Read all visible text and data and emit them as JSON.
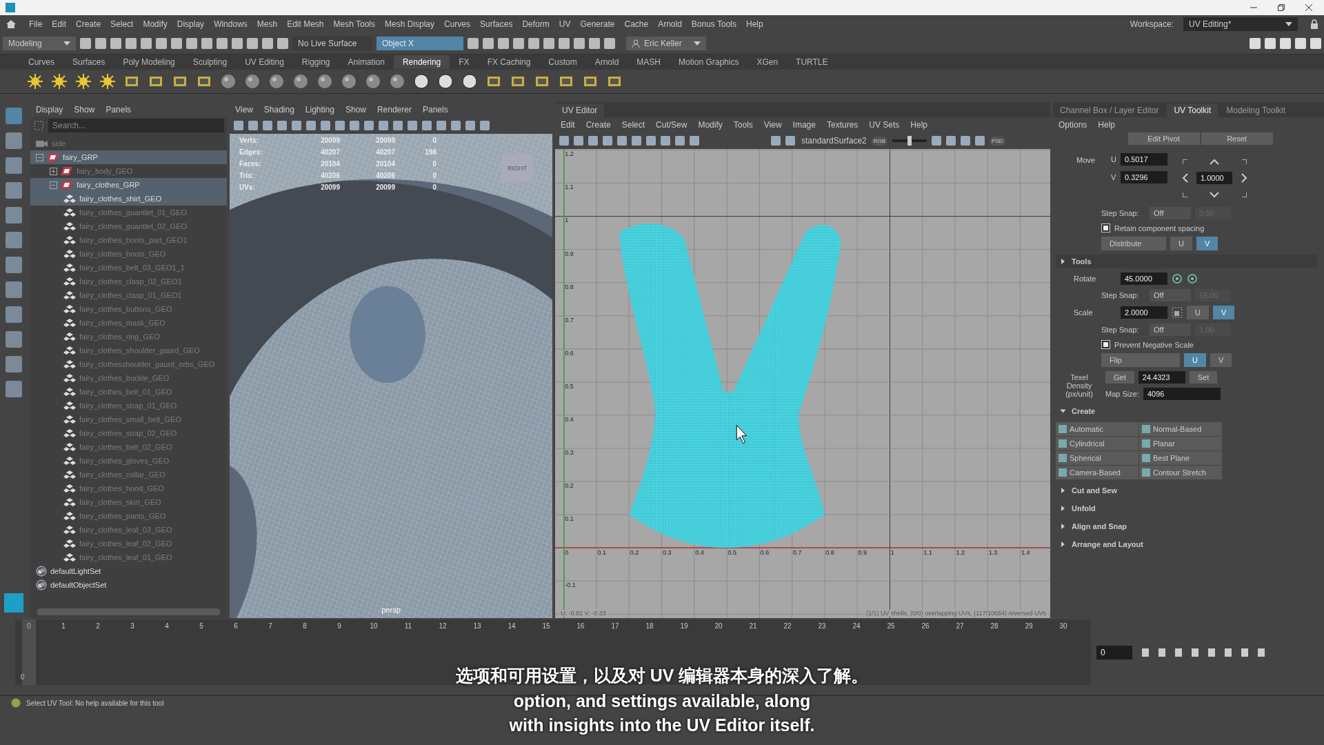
{
  "menu_bar": [
    "File",
    "Edit",
    "Create",
    "Select",
    "Modify",
    "Display",
    "Windows",
    "Mesh",
    "Edit Mesh",
    "Mesh Tools",
    "Mesh Display",
    "Curves",
    "Surfaces",
    "Deform",
    "UV",
    "Generate",
    "Cache",
    "Arnold",
    "Bonus Tools",
    "Help"
  ],
  "status_line": {
    "mode": "Modeling",
    "live_surface": "No Live Surface",
    "symmetry": "Object X",
    "user": "Eric Keller",
    "workspace_label": "Workspace:",
    "workspace": "UV Editing*"
  },
  "shelf": {
    "tabs": [
      {
        "label": "Curves",
        "selected": false
      },
      {
        "label": "Surfaces",
        "selected": false
      },
      {
        "label": "Poly Modeling",
        "selected": false
      },
      {
        "label": "Sculpting",
        "selected": false
      },
      {
        "label": "UV Editing",
        "selected": false
      },
      {
        "label": "Rigging",
        "selected": false
      },
      {
        "label": "Animation",
        "selected": false
      },
      {
        "label": "Rendering",
        "selected": true
      },
      {
        "label": "FX",
        "selected": false
      },
      {
        "label": "FX Caching",
        "selected": false
      },
      {
        "label": "Custom",
        "selected": false
      },
      {
        "label": "Arnold",
        "selected": false
      },
      {
        "label": "MASH",
        "selected": false
      },
      {
        "label": "Motion Graphics",
        "selected": false
      },
      {
        "label": "XGen",
        "selected": false
      },
      {
        "label": "TURTLE",
        "selected": false
      }
    ]
  },
  "outliner": {
    "menu": [
      "Display",
      "Show",
      "Panels"
    ],
    "search": {
      "placeholder": "Search..."
    },
    "tree": [
      {
        "label": "side",
        "kind": "camera",
        "hidden": true,
        "selected": false
      },
      {
        "label": "fairy_GRP",
        "kind": "group",
        "expanded": true,
        "hidden": false,
        "selected": true,
        "children": [
          {
            "label": "fairy_body_GEO",
            "kind": "group",
            "expanded": false,
            "hidden": true,
            "selected": false
          },
          {
            "label": "fairy_clothes_GRP",
            "kind": "group",
            "expanded": true,
            "hidden": false,
            "selected": true,
            "children": [
              {
                "label": "fairy_clothes_shirt_GEO",
                "kind": "mesh",
                "hidden": false,
                "selected": true
              },
              {
                "label": "fairy_clothes_guantlet_01_GEO",
                "kind": "mesh",
                "hidden": true,
                "selected": false
              },
              {
                "label": "fairy_clothes_guantlet_02_GEO",
                "kind": "mesh",
                "hidden": true,
                "selected": false
              },
              {
                "label": "fairy_clothes_boots_part_GEO1",
                "kind": "mesh",
                "hidden": true,
                "selected": false
              },
              {
                "label": "fairy_clothes_boots_GEO",
                "kind": "mesh",
                "hidden": true,
                "selected": false
              },
              {
                "label": "fairy_clothes_belt_03_GEO1_1",
                "kind": "mesh",
                "hidden": true,
                "selected": false
              },
              {
                "label": "fairy_clothes_clasp_02_GEO1",
                "kind": "mesh",
                "hidden": true,
                "selected": false
              },
              {
                "label": "fairy_clothes_clasp_01_GEO1",
                "kind": "mesh",
                "hidden": true,
                "selected": false
              },
              {
                "label": "fairy_clothes_buttons_GEO",
                "kind": "mesh",
                "hidden": true,
                "selected": false
              },
              {
                "label": "fairy_clothes_mask_GEO",
                "kind": "mesh",
                "hidden": true,
                "selected": false
              },
              {
                "label": "fairy_clothes_ring_GEO",
                "kind": "mesh",
                "hidden": true,
                "selected": false
              },
              {
                "label": "fairy_clothes_shoulder_gaurd_GEO",
                "kind": "mesh",
                "hidden": true,
                "selected": false
              },
              {
                "label": "fairy_clothesshoulder_gaurd_orbs_GEO",
                "kind": "mesh",
                "hidden": true,
                "selected": false
              },
              {
                "label": "fairy_clothes_buckle_GEO",
                "kind": "mesh",
                "hidden": true,
                "selected": false
              },
              {
                "label": "fairy_clothes_belt_01_GEO",
                "kind": "mesh",
                "hidden": true,
                "selected": false
              },
              {
                "label": "fairy_clothes_strap_01_GEO",
                "kind": "mesh",
                "hidden": true,
                "selected": false
              },
              {
                "label": "fairy_clothes_small_belt_GEO",
                "kind": "mesh",
                "hidden": true,
                "selected": false
              },
              {
                "label": "fairy_clothes_strap_02_GEO",
                "kind": "mesh",
                "hidden": true,
                "selected": false
              },
              {
                "label": "fairy_clothes_belt_02_GEO",
                "kind": "mesh",
                "hidden": true,
                "selected": false
              },
              {
                "label": "fairy_clothes_gloves_GEO",
                "kind": "mesh",
                "hidden": true,
                "selected": false
              },
              {
                "label": "fairy_clothes_collar_GEO",
                "kind": "mesh",
                "hidden": true,
                "selected": false
              },
              {
                "label": "fairy_clothes_hood_GEO",
                "kind": "mesh",
                "hidden": true,
                "selected": false
              },
              {
                "label": "fairy_clothes_skirt_GEO",
                "kind": "mesh",
                "hidden": true,
                "selected": false
              },
              {
                "label": "fairy_clothes_pants_GEO",
                "kind": "mesh",
                "hidden": true,
                "selected": false
              },
              {
                "label": "fairy_clothes_leaf_03_GEO",
                "kind": "mesh",
                "hidden": true,
                "selected": false
              },
              {
                "label": "fairy_clothes_leaf_02_GEO",
                "kind": "mesh",
                "hidden": true,
                "selected": false
              },
              {
                "label": "fairy_clothes_leaf_01_GEO",
                "kind": "mesh",
                "hidden": true,
                "selected": false
              }
            ]
          }
        ]
      },
      {
        "label": "defaultLightSet",
        "kind": "set",
        "hidden": false,
        "selected": false
      },
      {
        "label": "defaultObjectSet",
        "kind": "set",
        "hidden": false,
        "selected": false
      }
    ]
  },
  "viewport": {
    "menu": [
      "View",
      "Shading",
      "Lighting",
      "Show",
      "Renderer",
      "Panels"
    ],
    "stats": [
      {
        "label": "Verts:",
        "values": [
          "20099",
          "20099",
          "0"
        ]
      },
      {
        "label": "Edges:",
        "values": [
          "40207",
          "40207",
          "198"
        ]
      },
      {
        "label": "Faces:",
        "values": [
          "20104",
          "20104",
          "0"
        ]
      },
      {
        "label": "Tris:",
        "values": [
          "40206",
          "40206",
          "0"
        ]
      },
      {
        "label": "UVs:",
        "values": [
          "20099",
          "20099",
          "0"
        ]
      }
    ],
    "view_cube": "RIGHT",
    "camera": "persp"
  },
  "uv_editor": {
    "title": "UV Editor",
    "menu": [
      "Edit",
      "Create",
      "Select",
      "Cut/Sew",
      "Modify",
      "Tools",
      "View",
      "Image",
      "Textures",
      "UV Sets",
      "Help"
    ],
    "texture": "standardSurface2",
    "exposure": {
      "level": 0.5
    },
    "channel_button": "RGB",
    "psd_button": "PSD",
    "u_labels": [
      "0",
      "0.1",
      "0.2",
      "0.3",
      "0.4",
      "0.5",
      "0.6",
      "0.7",
      "0.8",
      "0.9",
      "1",
      "1.1",
      "1.2",
      "1.3",
      "1.4"
    ],
    "v_labels": [
      "1.2",
      "1.1",
      "1",
      "0.9",
      "0.8",
      "0.7",
      "0.6",
      "0.5",
      "0.4",
      "0.3",
      "0.2",
      "0.1",
      "-0.1"
    ],
    "cursor_readout": "U: -0.82  V: -0.33",
    "info": "(1/1) UV shells, (0/0) overlapping UVs, (117/10654) reversed UVs"
  },
  "uv_toolkit": {
    "tabs": [
      {
        "label": "Channel Box / Layer Editor",
        "selected": false
      },
      {
        "label": "UV Toolkit",
        "selected": true
      },
      {
        "label": "Modeling Toolkit",
        "selected": false
      }
    ],
    "menu": [
      "Options",
      "Help"
    ],
    "pivot_buttons": [
      "Edit Pivot",
      "Reset"
    ],
    "move": {
      "label": "Move",
      "u_label": "U",
      "u": "0.5017",
      "v_label": "V",
      "v": "0.3296",
      "step": "1.0000",
      "step_snap": {
        "label": "Step Snap:",
        "value": "Off",
        "amount": "0.50"
      },
      "retain": {
        "label": "Retain component spacing",
        "checked": true
      },
      "distribute": {
        "label": "Distribute",
        "axes": [
          {
            "label": "U",
            "selected": false
          },
          {
            "label": "V",
            "selected": true
          }
        ]
      }
    },
    "tools": {
      "label": "Tools",
      "expanded": false
    },
    "rotate": {
      "label": "Rotate",
      "value": "45.0000",
      "step_snap": {
        "label": "Step Snap:",
        "value": "Off",
        "amount": "15.00"
      }
    },
    "scale": {
      "label": "Scale",
      "value": "2.0000",
      "axes": [
        {
          "label": "U",
          "selected": false
        },
        {
          "label": "V",
          "selected": true
        }
      ],
      "step_snap": {
        "label": "Step Snap:",
        "value": "Off",
        "amount": "1.00"
      },
      "prevent": {
        "label": "Prevent Negative Scale",
        "checked": true
      },
      "flip": {
        "label": "Flip",
        "axes": [
          {
            "label": "U",
            "selected": true
          },
          {
            "label": "V",
            "selected": false
          }
        ]
      }
    },
    "texel": {
      "label": "Texel Density (px/unit)",
      "get": "Get",
      "value": "24.4323",
      "set": "Set",
      "map_size_label": "Map Size:",
      "map_size": "4096"
    },
    "create": {
      "label": "Create",
      "expanded": true,
      "buttons": [
        "Automatic",
        "Normal-Based",
        "Cylindrical",
        "Planar",
        "Spherical",
        "Best Plane",
        "Camera-Based",
        "Contour Stretch"
      ]
    },
    "sections": [
      {
        "label": "Cut and Sew",
        "expanded": false
      },
      {
        "label": "Unfold",
        "expanded": false
      },
      {
        "label": "Align and Snap",
        "expanded": false
      },
      {
        "label": "Arrange and Layout",
        "expanded": false
      }
    ]
  },
  "timeline": {
    "frames": [
      "0",
      "1",
      "2",
      "3",
      "4",
      "5",
      "6",
      "7",
      "8",
      "9",
      "10",
      "11",
      "12",
      "13",
      "14",
      "15",
      "16",
      "17",
      "18",
      "19",
      "20",
      "21",
      "22",
      "23",
      "24",
      "25",
      "26",
      "27",
      "28",
      "29",
      "30"
    ],
    "range_start": "0",
    "current_frame": "0",
    "level": 0
  },
  "help_line": "Select UV Tool: No help available for this tool",
  "subtitles": [
    "选项和可用设置，以及对 UV 编辑器本身的深入了解。",
    "option, and settings available, along",
    "with insights into the UV Editor itself."
  ]
}
